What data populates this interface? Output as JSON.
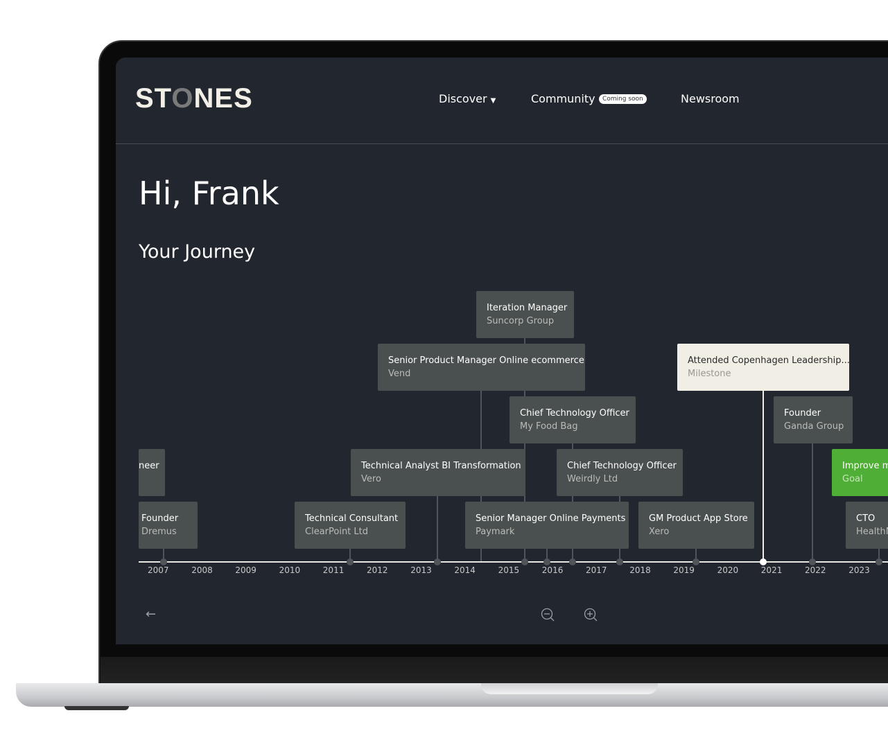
{
  "brand": {
    "logo": "STONES"
  },
  "nav": {
    "discover": "Discover",
    "community": "Community",
    "coming_soon": "Coming soon",
    "newsroom": "Newsroom"
  },
  "greeting": "Hi, Frank",
  "section_title": "Your Journey",
  "cards": [
    {
      "title": "Iteration Manager",
      "sub": "Suncorp Group"
    },
    {
      "title": "Senior Product Manager Online ecommerce",
      "sub": "Vend"
    },
    {
      "title": "Chief Technology Officer",
      "sub": "My Food Bag"
    },
    {
      "title": "neer",
      "sub": ""
    },
    {
      "title": "Technical Analyst BI Transformation",
      "sub": "Vero"
    },
    {
      "title": "Chief Technology Officer",
      "sub": "Weirdly Ltd"
    },
    {
      "title": "Founder",
      "sub": "Dremus"
    },
    {
      "title": "Technical Consultant",
      "sub": "ClearPoint Ltd"
    },
    {
      "title": "Senior Manager Online Payments",
      "sub": "Paymark"
    },
    {
      "title": "GM Product App Store",
      "sub": "Xero"
    },
    {
      "title": "Attended Copenhagen Leadership...",
      "sub": "Milestone"
    },
    {
      "title": "Founder",
      "sub": "Ganda Group"
    },
    {
      "title": "Improve m",
      "sub": "Goal"
    },
    {
      "title": "CTO",
      "sub": "HealthN"
    }
  ],
  "years": [
    "2007",
    "2008",
    "2009",
    "2010",
    "2011",
    "2012",
    "2013",
    "2014",
    "2015",
    "2016",
    "2017",
    "2018",
    "2019",
    "2020",
    "2021",
    "2022",
    "2023"
  ],
  "controls": {
    "back": "←",
    "zoom_out": "zoom-out-icon",
    "zoom_in": "zoom-in-icon"
  },
  "colors": {
    "background": "#22262e",
    "card": "#4a504f",
    "milestone": "#f1eee6",
    "goal": "#4fae35"
  }
}
